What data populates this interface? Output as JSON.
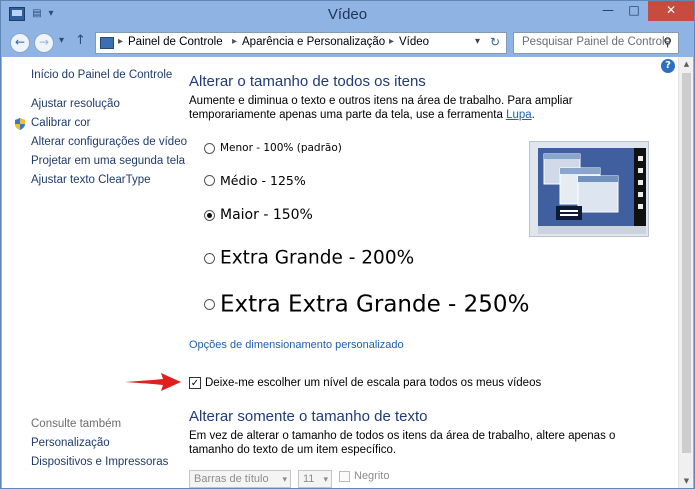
{
  "window": {
    "title": "Vídeo",
    "minimize": "—",
    "maximize": "□",
    "close": "✕"
  },
  "address": {
    "crumbs": [
      "Painel de Controle",
      "Aparência e Personalização",
      "Vídeo"
    ],
    "search_placeholder": "Pesquisar Painel de Controle"
  },
  "sidebar": {
    "home": "Início do Painel de Controle",
    "items": [
      "Ajustar resolução",
      "Calibrar cor",
      "Alterar configurações de vídeo",
      "Projetar em uma segunda tela",
      "Ajustar texto ClearType"
    ],
    "see_also_label": "Consulte também",
    "see_also": [
      "Personalização",
      "Dispositivos e Impressoras"
    ]
  },
  "main": {
    "heading1": "Alterar o tamanho de todos os itens",
    "desc1": "Aumente e diminua o texto e outros itens na área de trabalho. Para ampliar temporariamente apenas uma parte da tela, use a ferramenta ",
    "desc1_link": "Lupa",
    "desc1_end": ".",
    "options": [
      {
        "label": "Menor - 100% (padrão)",
        "selected": false
      },
      {
        "label": "Médio - 125%",
        "selected": false
      },
      {
        "label": "Maior - 150%",
        "selected": true
      },
      {
        "label": "Extra Grande - 200%",
        "selected": false
      },
      {
        "label": "Extra Extra Grande - 250%",
        "selected": false
      }
    ],
    "custom_link": "Opções de dimensionamento personalizado",
    "checkbox_label": "Deixe-me escolher um nível de escala para todos os meus vídeos",
    "checkbox_checked": true,
    "heading2": "Alterar somente o tamanho de texto",
    "desc2": "Em vez de alterar o tamanho de todos os itens da área de trabalho, altere apenas o tamanho do texto de um item específico.",
    "item_select": "Barras de título",
    "size_select": "11",
    "bold_label": "Negrito"
  },
  "colors": {
    "accent": "#1f3b78",
    "link": "#1f5fb0",
    "arrow": "#e0201e"
  }
}
